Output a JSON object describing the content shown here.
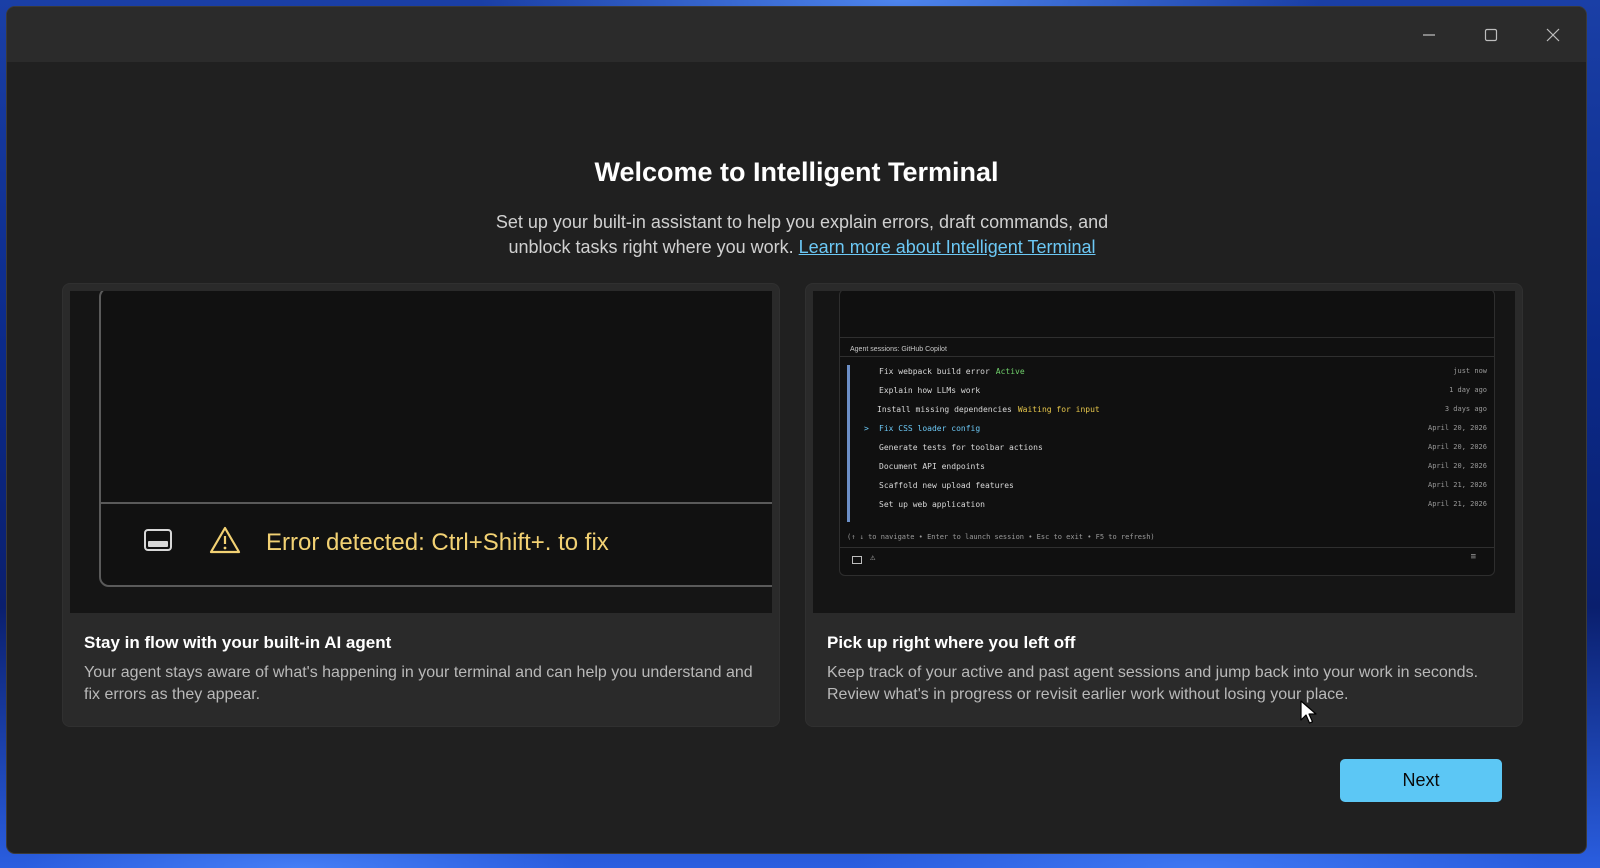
{
  "window": {
    "controls": {
      "minimize": "minimize-icon",
      "maximize": "maximize-icon",
      "close": "close-icon"
    }
  },
  "welcome": {
    "title": "Welcome to Intelligent Terminal",
    "subtitle": "Set up your built-in assistant to help you explain errors, draft commands, and unblock tasks right where you work.",
    "link": "Learn more about Intelligent Terminal"
  },
  "cards": [
    {
      "preview": {
        "error_text": "Error detected: Ctrl+Shift+. to fix",
        "icons": [
          "terminal-icon",
          "warning-icon"
        ]
      },
      "heading": "Stay in flow with your built-in AI agent",
      "body": "Your agent stays aware of what's happening in your terminal and can help you understand and fix errors as they appear."
    },
    {
      "preview": {
        "header": "Agent sessions: GitHub Copilot",
        "sessions": [
          {
            "title": "Fix webpack build error",
            "status": "Active",
            "time": "just now",
            "selected": false
          },
          {
            "title": "Explain how LLMs work",
            "status": "",
            "time": "1 day ago",
            "selected": false
          },
          {
            "title": "Install missing dependencies",
            "status": "Waiting for input",
            "time": "3 days ago",
            "selected": false
          },
          {
            "title": "Fix CSS loader config",
            "status": "",
            "time": "April 20, 2026",
            "selected": true
          },
          {
            "title": "Generate tests for toolbar actions",
            "status": "",
            "time": "April 20, 2026",
            "selected": false
          },
          {
            "title": "Document API endpoints",
            "status": "",
            "time": "April 20, 2026",
            "selected": false
          },
          {
            "title": "Scaffold new upload features",
            "status": "",
            "time": "April 21, 2026",
            "selected": false
          },
          {
            "title": "Set up web application",
            "status": "",
            "time": "April 21, 2026",
            "selected": false
          }
        ],
        "caret": ">",
        "help": "(↑ ↓ to navigate • Enter to launch session • Esc to exit • F5 to refresh)"
      },
      "heading": "Pick up right where you left off",
      "body": "Keep track of your active and past agent sessions and jump back into your work in seconds. Review what's in progress or revisit earlier work without losing your place."
    }
  ],
  "next_label": "Next",
  "colors": {
    "accent": "#5cc7f5",
    "link": "#6cc8f5",
    "error": "#f2d173",
    "active": "#6fcf6a",
    "waiting": "#e8c84b"
  }
}
